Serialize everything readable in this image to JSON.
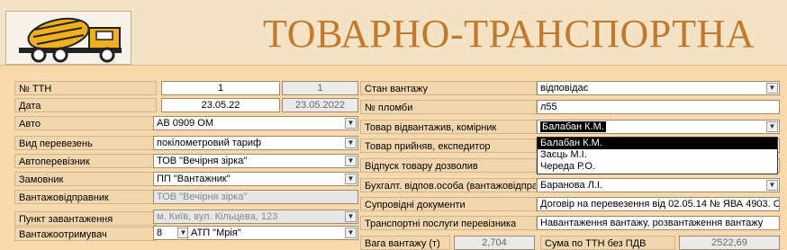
{
  "title": "ТОВАРНО-ТРАНСПОРТНА",
  "left": {
    "ttn": {
      "label": "№ ТТН",
      "value": "1",
      "value2": "1"
    },
    "date": {
      "label": "Дата",
      "value": "23.05.22",
      "value2": "23.05.2022"
    },
    "auto": {
      "label": "Авто",
      "value": "АВ 0909 ОМ"
    },
    "transport_type": {
      "label": "Вид перевезень",
      "value": "покілометровий тариф"
    },
    "carrier": {
      "label": "Автоперевізник",
      "value": "ТОВ \"Вечірня зірка\""
    },
    "customer": {
      "label": "Замовник",
      "value": "ПП \"Вантажник\""
    },
    "shipper": {
      "label": "Вантажовідправник",
      "value": "ТОВ \"Вечірня зірка\""
    },
    "load_point": {
      "label": "Пункт завантаження",
      "value": "м. Київ, вул. Кільцева, 123"
    },
    "receiver": {
      "label": "Вантажоотримувач",
      "code": "8",
      "value": "АТП \"Мрія\""
    }
  },
  "right": {
    "cargo_state": {
      "label": "Стан вантажу",
      "value": "відповідає"
    },
    "seal": {
      "label": "№ пломби",
      "value": "л55"
    },
    "shipped_by": {
      "label": "Товар відвантажив, комірник",
      "value": "Балабан К.М."
    },
    "accepted_by": {
      "label": "Товар прийняв, експедитор"
    },
    "allowed_by": {
      "label": "Відпуск товару дозволив"
    },
    "accountant": {
      "label": "Бухгалт. відпов.особа (вантажовідпра",
      "value": "Баранова Л.І."
    },
    "docs": {
      "label": "Супровідні документи",
      "value": "Договір на перевезення від 02.05.14 № ЯВА 4903. С"
    },
    "services": {
      "label": "Транспортні послуги перевізника",
      "value": "Навантаження вантажу, розвантаження вантажу"
    }
  },
  "dropdown": {
    "options": [
      "Балабан К.М.",
      "Заєць М.І.",
      "Череда Р.О."
    ]
  },
  "bottom": {
    "weight_label": "Вага вантажу (т)",
    "weight_value": "2,704",
    "sum_label": "Сума по ТТН без ПДВ",
    "sum_value": "2522,69"
  }
}
